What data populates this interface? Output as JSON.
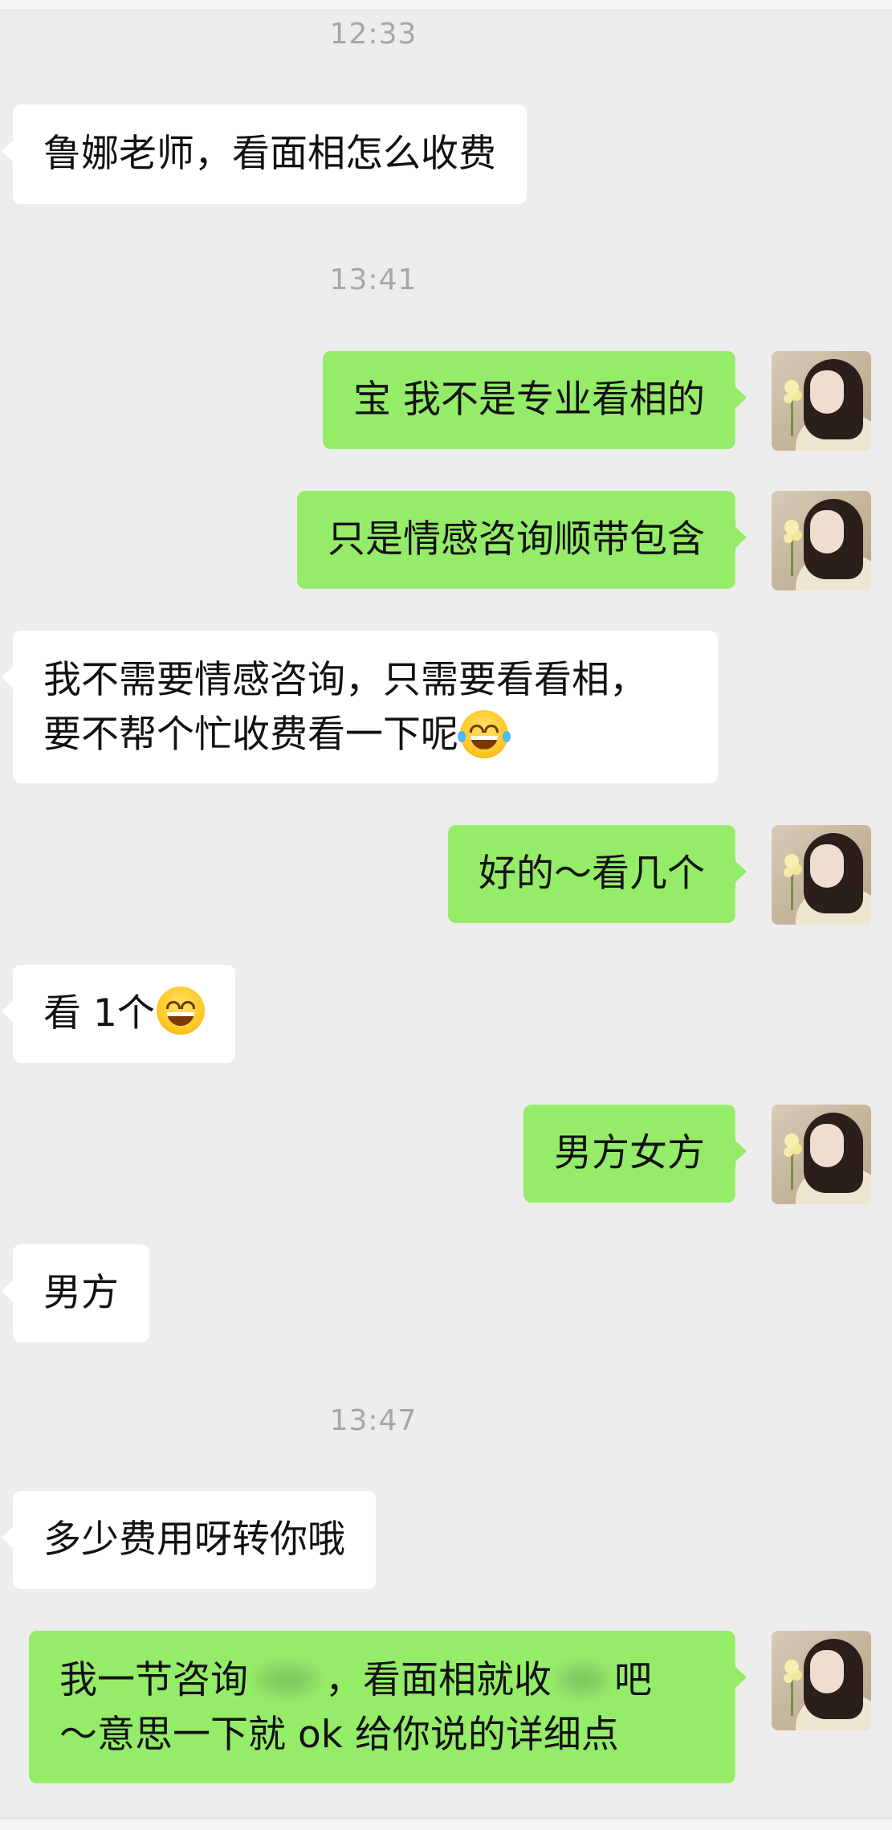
{
  "timestamps": [
    "12:33",
    "13:41",
    "13:47"
  ],
  "messages": [
    {
      "side": "in",
      "text": "鲁娜老师，看面相怎么收费"
    },
    {
      "side": "out",
      "text": "宝 我不是专业看相的"
    },
    {
      "side": "out",
      "text": "只是情感咨询顺带包含"
    },
    {
      "side": "in",
      "line1": "我不需要情感咨询，只需要看看相，",
      "line2": "要不帮个忙收费看一下呢",
      "emoji": "face-with-tears-of-joy"
    },
    {
      "side": "out",
      "text": "好的～看几个"
    },
    {
      "side": "in",
      "text": "看 1个",
      "emoji": "grinning-face"
    },
    {
      "side": "out",
      "text": "男方女方"
    },
    {
      "side": "in",
      "text": "男方"
    },
    {
      "side": "in",
      "text": "多少费用呀转你哦"
    },
    {
      "side": "out",
      "line1a": "我一节咨询",
      "line1b": "，看面相就收",
      "line1c": "吧",
      "line2": "～意思一下就 ok  给你说的详细点",
      "redacted": true
    }
  ],
  "colors": {
    "background": "#ededed",
    "incoming_bubble": "#ffffff",
    "outgoing_bubble": "#95ec69",
    "timestamp": "#a6a6a6"
  },
  "avatar": {
    "icon": "user-avatar-photo"
  }
}
